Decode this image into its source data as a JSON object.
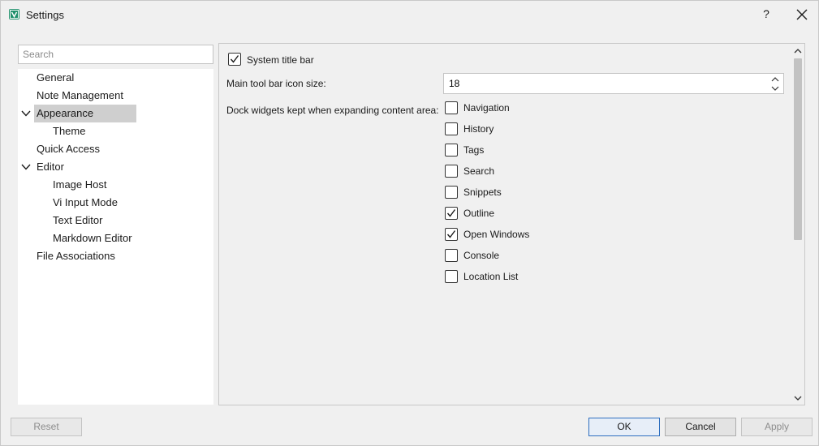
{
  "window": {
    "title": "Settings",
    "help_label": "?"
  },
  "icons": {
    "app": "app-logo-icon",
    "close": "close-icon",
    "chevron": "chevron-down-icon",
    "check": "checkmark-icon"
  },
  "colors": {
    "accent": "#2f6fbf",
    "app_logo": "#1d8f6a",
    "selected_item": "#cfcfcf"
  },
  "search": {
    "placeholder": "Search",
    "value": ""
  },
  "tree": {
    "items": [
      {
        "label": "General"
      },
      {
        "label": "Note Management"
      },
      {
        "label": "Appearance",
        "expanded": true,
        "selected": true
      },
      {
        "label": "Theme"
      },
      {
        "label": "Quick Access"
      },
      {
        "label": "Editor",
        "expanded": true
      },
      {
        "label": "Image Host"
      },
      {
        "label": "Vi Input Mode"
      },
      {
        "label": "Text Editor"
      },
      {
        "label": "Markdown Editor"
      },
      {
        "label": "File Associations"
      }
    ]
  },
  "appearance": {
    "system_title_bar": {
      "label": "System title bar",
      "checked": true
    },
    "icon_size": {
      "label": "Main tool bar icon size:",
      "value": "18"
    },
    "dock_widgets": {
      "label": "Dock widgets kept when expanding content area:",
      "options": [
        {
          "label": "Navigation",
          "checked": false
        },
        {
          "label": "History",
          "checked": false
        },
        {
          "label": "Tags",
          "checked": false
        },
        {
          "label": "Search",
          "checked": false
        },
        {
          "label": "Snippets",
          "checked": false
        },
        {
          "label": "Outline",
          "checked": true
        },
        {
          "label": "Open Windows",
          "checked": true
        },
        {
          "label": "Console",
          "checked": false
        },
        {
          "label": "Location List",
          "checked": false
        }
      ]
    }
  },
  "buttons": {
    "reset": "Reset",
    "ok": "OK",
    "cancel": "Cancel",
    "apply": "Apply"
  }
}
